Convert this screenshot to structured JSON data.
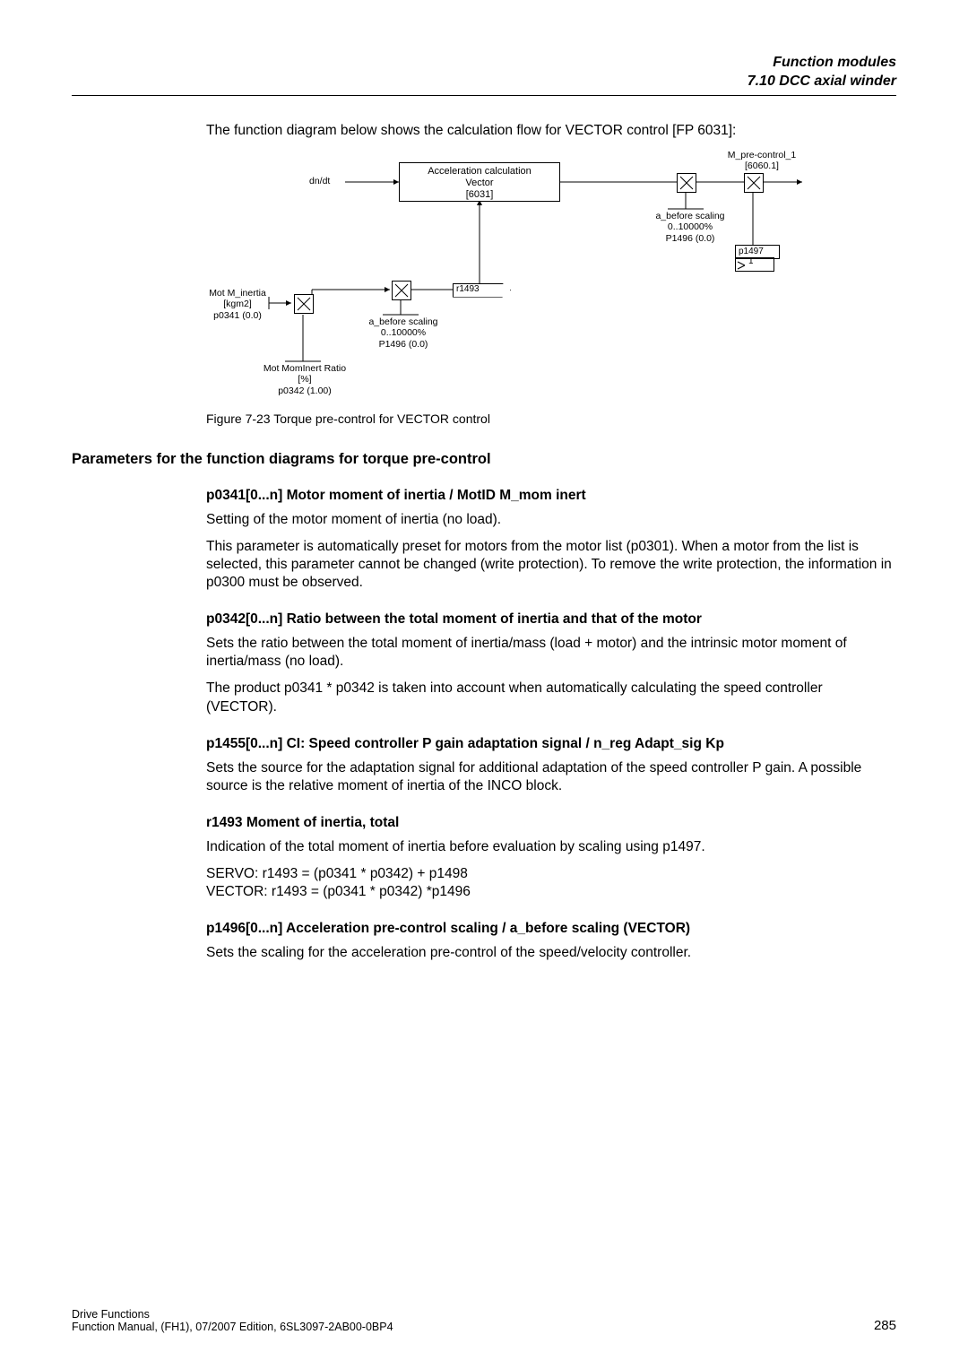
{
  "header": {
    "line1": "Function modules",
    "line2": "7.10 DCC axial winder"
  },
  "intro": "The function diagram below shows the calculation flow for VECTOR control [FP 6031]:",
  "diagram": {
    "dn_dt": "dn/dt",
    "accel_box_l1": "Acceleration calculation",
    "accel_box_l2": "Vector",
    "accel_box_l3": "[6031]",
    "m_pre_l1": "M_pre-control_1",
    "m_pre_l2": "[6060.1]",
    "a_before_top_l1": "a_before scaling",
    "a_before_top_l2": "0..10000%",
    "a_before_top_l3": "P1496 (0.0)",
    "p1497": "p1497",
    "one": "1",
    "r1493": "r1493",
    "mot_m_inertia_l1": "Mot M_inertia",
    "mot_m_inertia_l2": "[kgm2]",
    "mot_m_inertia_l3": "p0341 (0.0)",
    "a_before_bot_l1": "a_before scaling",
    "a_before_bot_l2": "0..10000%",
    "a_before_bot_l3": "P1496 (0.0)",
    "mom_inert_ratio_l1": "Mot MomInert Ratio",
    "mom_inert_ratio_l2": "[%]",
    "mom_inert_ratio_l3": "p0342 (1.00)"
  },
  "fig_caption": "Figure 7-23    Torque pre-control for VECTOR control",
  "section_h": "Parameters for the function diagrams for torque pre-control",
  "s1": {
    "h": "p0341[0...n] Motor moment of inertia / MotID M_mom inert",
    "p1": "Setting of the motor moment of inertia (no load).",
    "p2": "This parameter is automatically preset for motors from the motor list (p0301). When a motor from the list is selected, this parameter cannot be changed (write protection). To remove the write protection, the information in p0300 must be observed."
  },
  "s2": {
    "h": "p0342[0...n] Ratio between the total moment of inertia and that of the motor",
    "p1": "Sets the ratio between the total moment of inertia/mass (load + motor) and the intrinsic motor moment of inertia/mass (no load).",
    "p2": "The product p0341 * p0342 is taken into account when automatically calculating the speed controller (VECTOR)."
  },
  "s3": {
    "h": "p1455[0...n] CI: Speed controller P gain adaptation signal / n_reg Adapt_sig Kp",
    "p1": "Sets the source for the adaptation signal for additional adaptation of the speed controller P gain. A possible source is the relative moment of inertia of the INCO block."
  },
  "s4": {
    "h": "r1493 Moment of inertia, total",
    "p1": "Indication of the total moment of inertia before evaluation by scaling using p1497.",
    "p2": "SERVO: r1493 = (p0341 * p0342) + p1498",
    "p3": "VECTOR: r1493 = (p0341 * p0342) *p1496"
  },
  "s5": {
    "h": "p1496[0...n] Acceleration pre-control scaling / a_before scaling (VECTOR)",
    "p1": "Sets the scaling for the acceleration pre-control of the speed/velocity controller."
  },
  "footer": {
    "l1": "Drive Functions",
    "l2": "Function Manual, (FH1), 07/2007 Edition, 6SL3097-2AB00-0BP4",
    "page": "285"
  }
}
